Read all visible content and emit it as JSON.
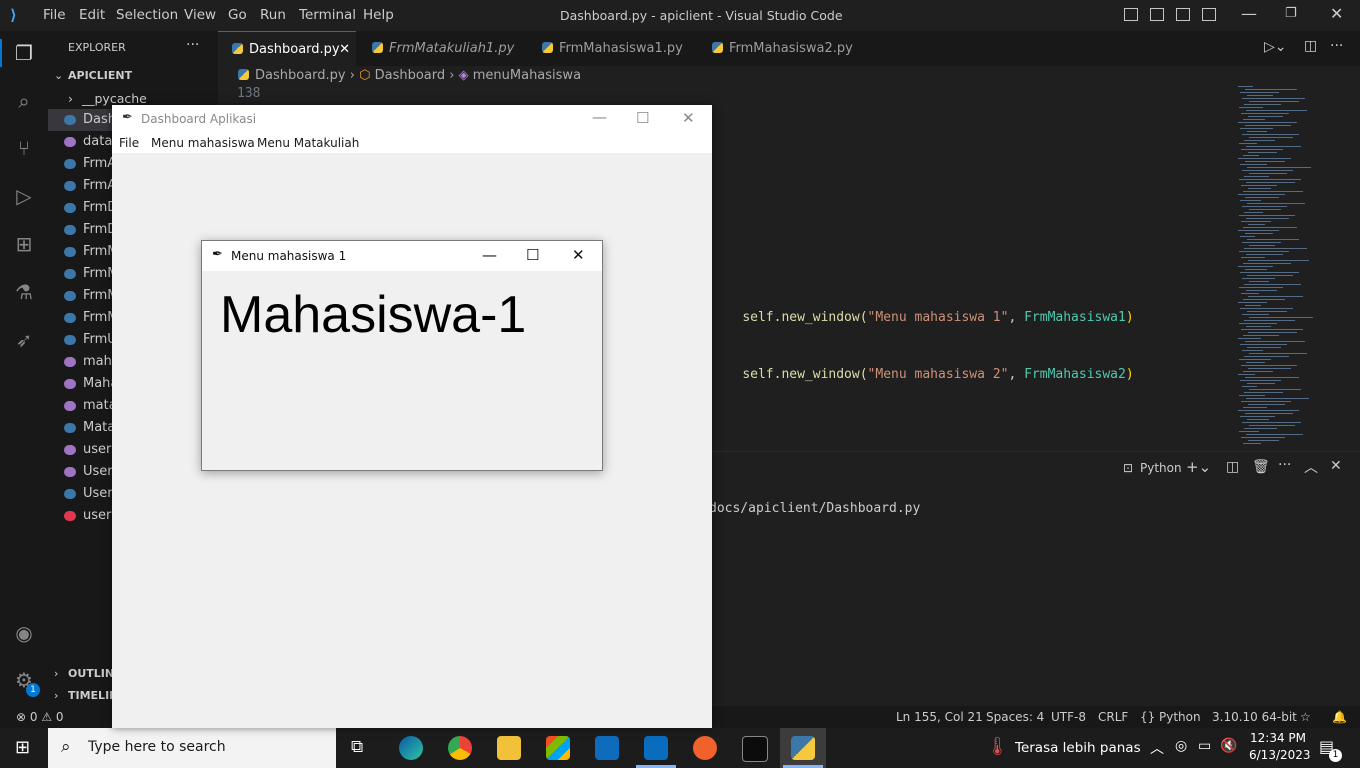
{
  "vscode": {
    "menu": [
      "File",
      "Edit",
      "Selection",
      "View",
      "Go",
      "Run",
      "Terminal",
      "Help"
    ],
    "title": "Dashboard.py - apiclient - Visual Studio Code",
    "tabs": [
      "Dashboard.py",
      "FrmMatakuliah1.py",
      "FrmMahasiswa1.py",
      "FrmMahasiswa2.py"
    ],
    "breadcrumb": [
      "Dashboard.py",
      "Dashboard",
      "menuMahasiswa"
    ],
    "line_number": "138",
    "explorer": {
      "header": "EXPLORER",
      "project": "APICLIENT",
      "folder": "__pycache__",
      "files": [
        "Dash",
        "datab",
        "FrmA",
        "FrmA",
        "FrmD",
        "FrmD",
        "FrmM",
        "FrmM",
        "FrmM",
        "FrmM",
        "FrmU",
        "maha",
        "Maha",
        "mata",
        "Mata",
        "users",
        "Users",
        "Users",
        "users"
      ],
      "outline": "OUTLINE",
      "timeline": "TIMELINE"
    },
    "code": {
      "line1": {
        "pre": "self.new_window(",
        "str": "\"Menu mahasiswa 1\"",
        "sep": ", ",
        "cls": "FrmMahasiswa1",
        "end": ")"
      },
      "line2": {
        "pre": "self.new_window(",
        "str": "\"Menu mahasiswa 2\"",
        "sep": ", ",
        "cls": "FrmMahasiswa2",
        "end": ")"
      }
    },
    "terminal": {
      "label": "Python",
      "path_line": "docs/apiclient/Dashboard.py"
    },
    "status": {
      "errors": "0",
      "warnings": "0",
      "position": "Ln 155, Col 21",
      "spaces": "Spaces: 4",
      "encoding": "UTF-8",
      "eol": "CRLF",
      "language": "Python",
      "interpreter": "3.10.10 64-bit"
    },
    "badge": "1"
  },
  "dashboard_window": {
    "title": "Dashboard Aplikasi",
    "menu": [
      "File",
      "Menu mahasiswa",
      "Menu Matakuliah"
    ]
  },
  "mahasiswa_window": {
    "title": "Menu mahasiswa 1",
    "label": "Mahasiswa-1"
  },
  "taskbar": {
    "search_placeholder": "Type here to search",
    "weather": "Terasa lebih panas",
    "time": "12:34 PM",
    "date": "6/13/2023",
    "notifications": "1"
  },
  "colors": {
    "accent": "#0078d4",
    "code_string": "#ce9178",
    "code_class": "#4ec9b0",
    "code_text": "#dcdcaa"
  }
}
